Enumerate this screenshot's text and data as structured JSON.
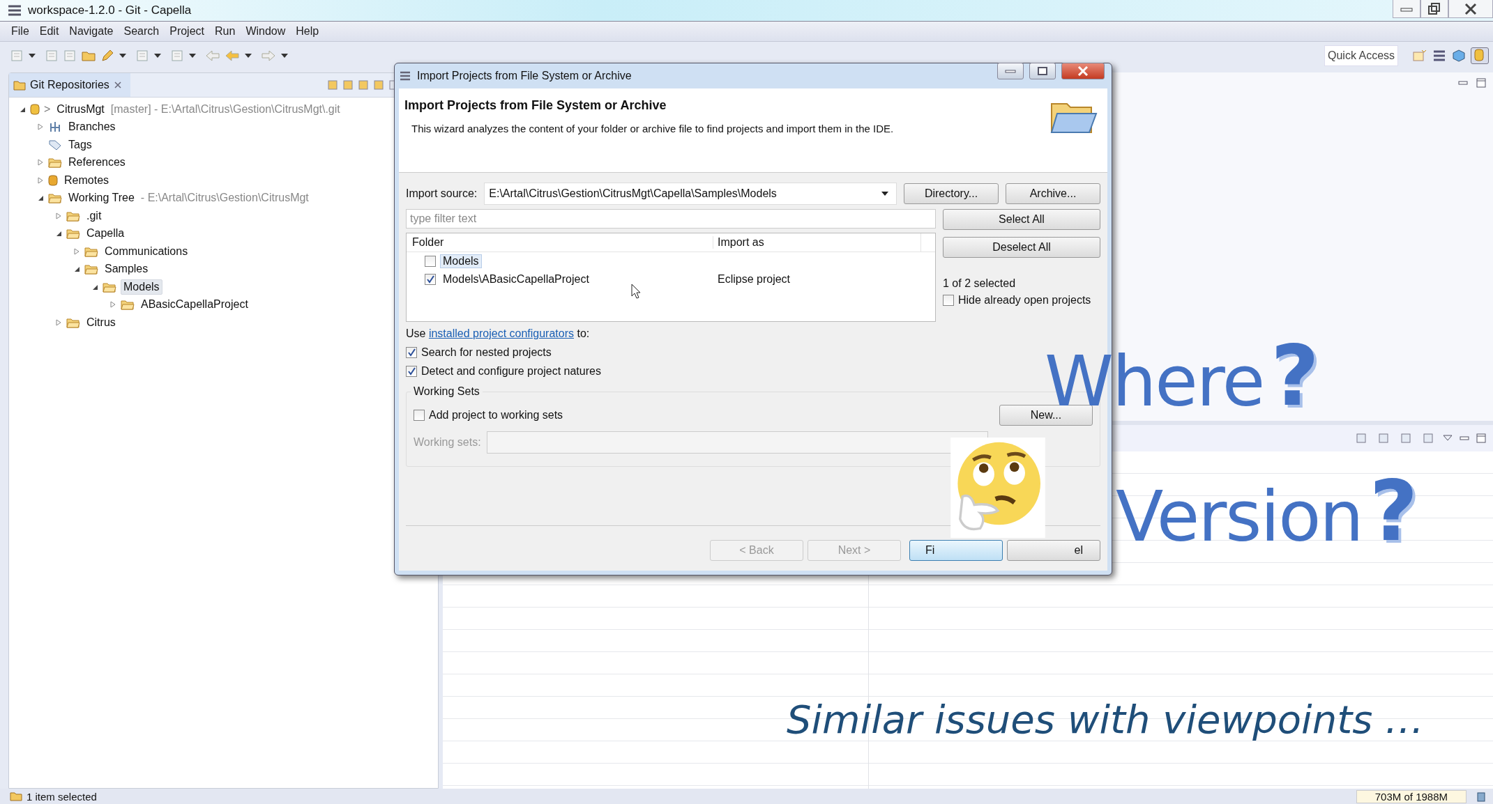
{
  "window": {
    "title": "workspace-1.2.0 - Git - Capella"
  },
  "menu": [
    "File",
    "Edit",
    "Navigate",
    "Search",
    "Project",
    "Run",
    "Window",
    "Help"
  ],
  "quick_access": {
    "placeholder": "Quick Access"
  },
  "git_repositories": {
    "tab": "Git Repositories",
    "tree": [
      {
        "kind": "repo",
        "prefix": ">",
        "label": "CitrusMgt",
        "detail": "[master] - E:\\Artal\\Citrus\\Gestion\\CitrusMgt\\.git",
        "expanded": true,
        "selected": false,
        "children": [
          {
            "kind": "branches",
            "label": "Branches",
            "expanded": false,
            "selected": false
          },
          {
            "kind": "tags",
            "label": "Tags",
            "selected": false
          },
          {
            "kind": "folder",
            "label": "References",
            "expanded": false,
            "selected": false
          },
          {
            "kind": "remotes",
            "label": "Remotes",
            "expanded": false,
            "selected": false
          },
          {
            "kind": "folder",
            "label": "Working Tree",
            "detail": "- E:\\Artal\\Citrus\\Gestion\\CitrusMgt",
            "expanded": true,
            "selected": false,
            "children": [
              {
                "kind": "folder",
                "label": ".git",
                "expanded": false,
                "selected": false
              },
              {
                "kind": "folder",
                "label": "Capella",
                "expanded": true,
                "selected": false,
                "children": [
                  {
                    "kind": "folder",
                    "label": "Communications",
                    "expanded": false,
                    "selected": false
                  },
                  {
                    "kind": "folder",
                    "label": "Samples",
                    "expanded": true,
                    "selected": false,
                    "children": [
                      {
                        "kind": "folder",
                        "label": "Models",
                        "expanded": true,
                        "selected": true,
                        "children": [
                          {
                            "kind": "folder",
                            "label": "ABasicCapellaProject",
                            "expanded": false,
                            "selected": false
                          }
                        ]
                      }
                    ]
                  }
                ]
              },
              {
                "kind": "folder",
                "label": "Citrus",
                "expanded": false,
                "selected": false
              }
            ]
          }
        ]
      }
    ]
  },
  "dialog": {
    "title": "Import Projects from File System or Archive",
    "heading": "Import Projects from File System or Archive",
    "description": "This wizard analyzes the content of your folder or archive file to find projects and import them in the IDE.",
    "import_source": {
      "label": "Import source:",
      "value": "E:\\Artal\\Citrus\\Gestion\\CitrusMgt\\Capella\\Samples\\Models"
    },
    "source_buttons": [
      "Directory...",
      "Archive..."
    ],
    "filter": {
      "placeholder": "type filter text"
    },
    "table": {
      "columns": [
        "Folder",
        "Import as"
      ],
      "rows": [
        {
          "folder": "Models",
          "checked": false,
          "selected": true
        },
        {
          "folder": "Models\\ABasicCapellaProject",
          "import_as": "Eclipse project",
          "checked": true,
          "selected": false
        }
      ]
    },
    "select_buttons": [
      "Select All",
      "Deselect All"
    ],
    "selection_count": "1 of 2 selected",
    "hide_open": {
      "label": "Hide already open projects",
      "checked": false
    },
    "configurators": {
      "before": "Use",
      "link": "installed project configurators",
      "after": "to:"
    },
    "options": [
      {
        "label": "Search for nested projects",
        "checked": true
      },
      {
        "label": "Detect and configure project natures",
        "checked": true
      }
    ],
    "working_sets": {
      "title": "Working Sets",
      "add": {
        "label": "Add project to working sets",
        "checked": false
      },
      "new_button": "New...",
      "sets_label": "Working sets:",
      "disabled": true
    },
    "footer_buttons": [
      {
        "label": "< Back",
        "disabled": true,
        "default": false
      },
      {
        "label": "Next >",
        "disabled": true,
        "default": false
      },
      {
        "label": "Fi",
        "disabled": false,
        "default": true
      },
      {
        "label": "el",
        "disabled": false,
        "default": false
      }
    ]
  },
  "status_bar": {
    "message": "1 item selected",
    "memory": "703M of 1988M"
  },
  "overlay": {
    "question_1": {
      "word": "Where",
      "mark": "?"
    },
    "question_2": {
      "word": "Version",
      "mark": "?"
    },
    "caption": "Similar issues with viewpoints …"
  }
}
